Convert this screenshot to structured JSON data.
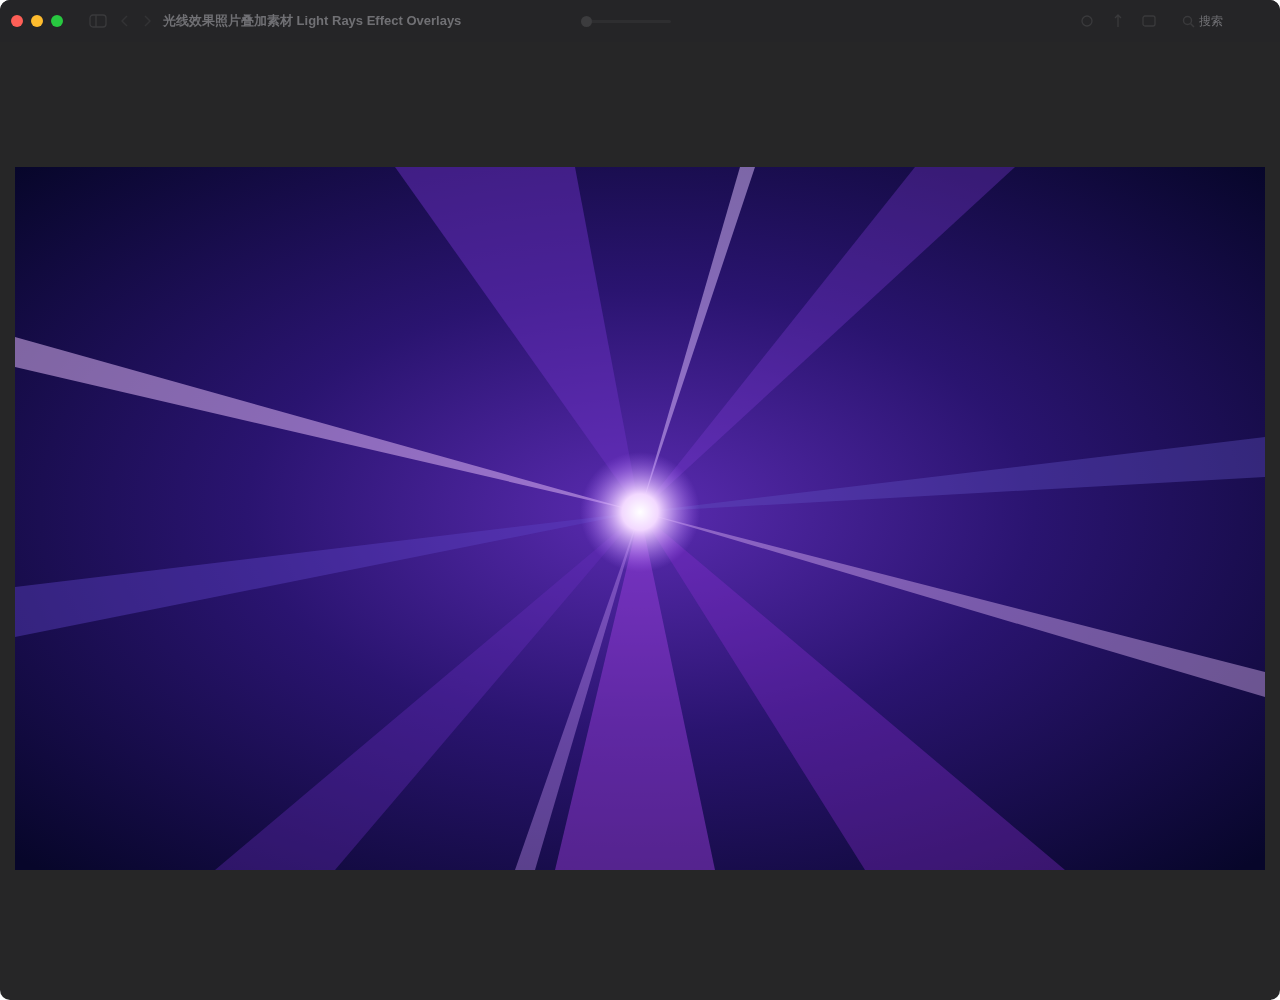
{
  "window": {
    "title": "光线效果照片叠加素材 Light Rays Effect Overlays"
  },
  "zoom_slider": {
    "level": 0.0
  },
  "search": {
    "placeholder": "搜索"
  }
}
